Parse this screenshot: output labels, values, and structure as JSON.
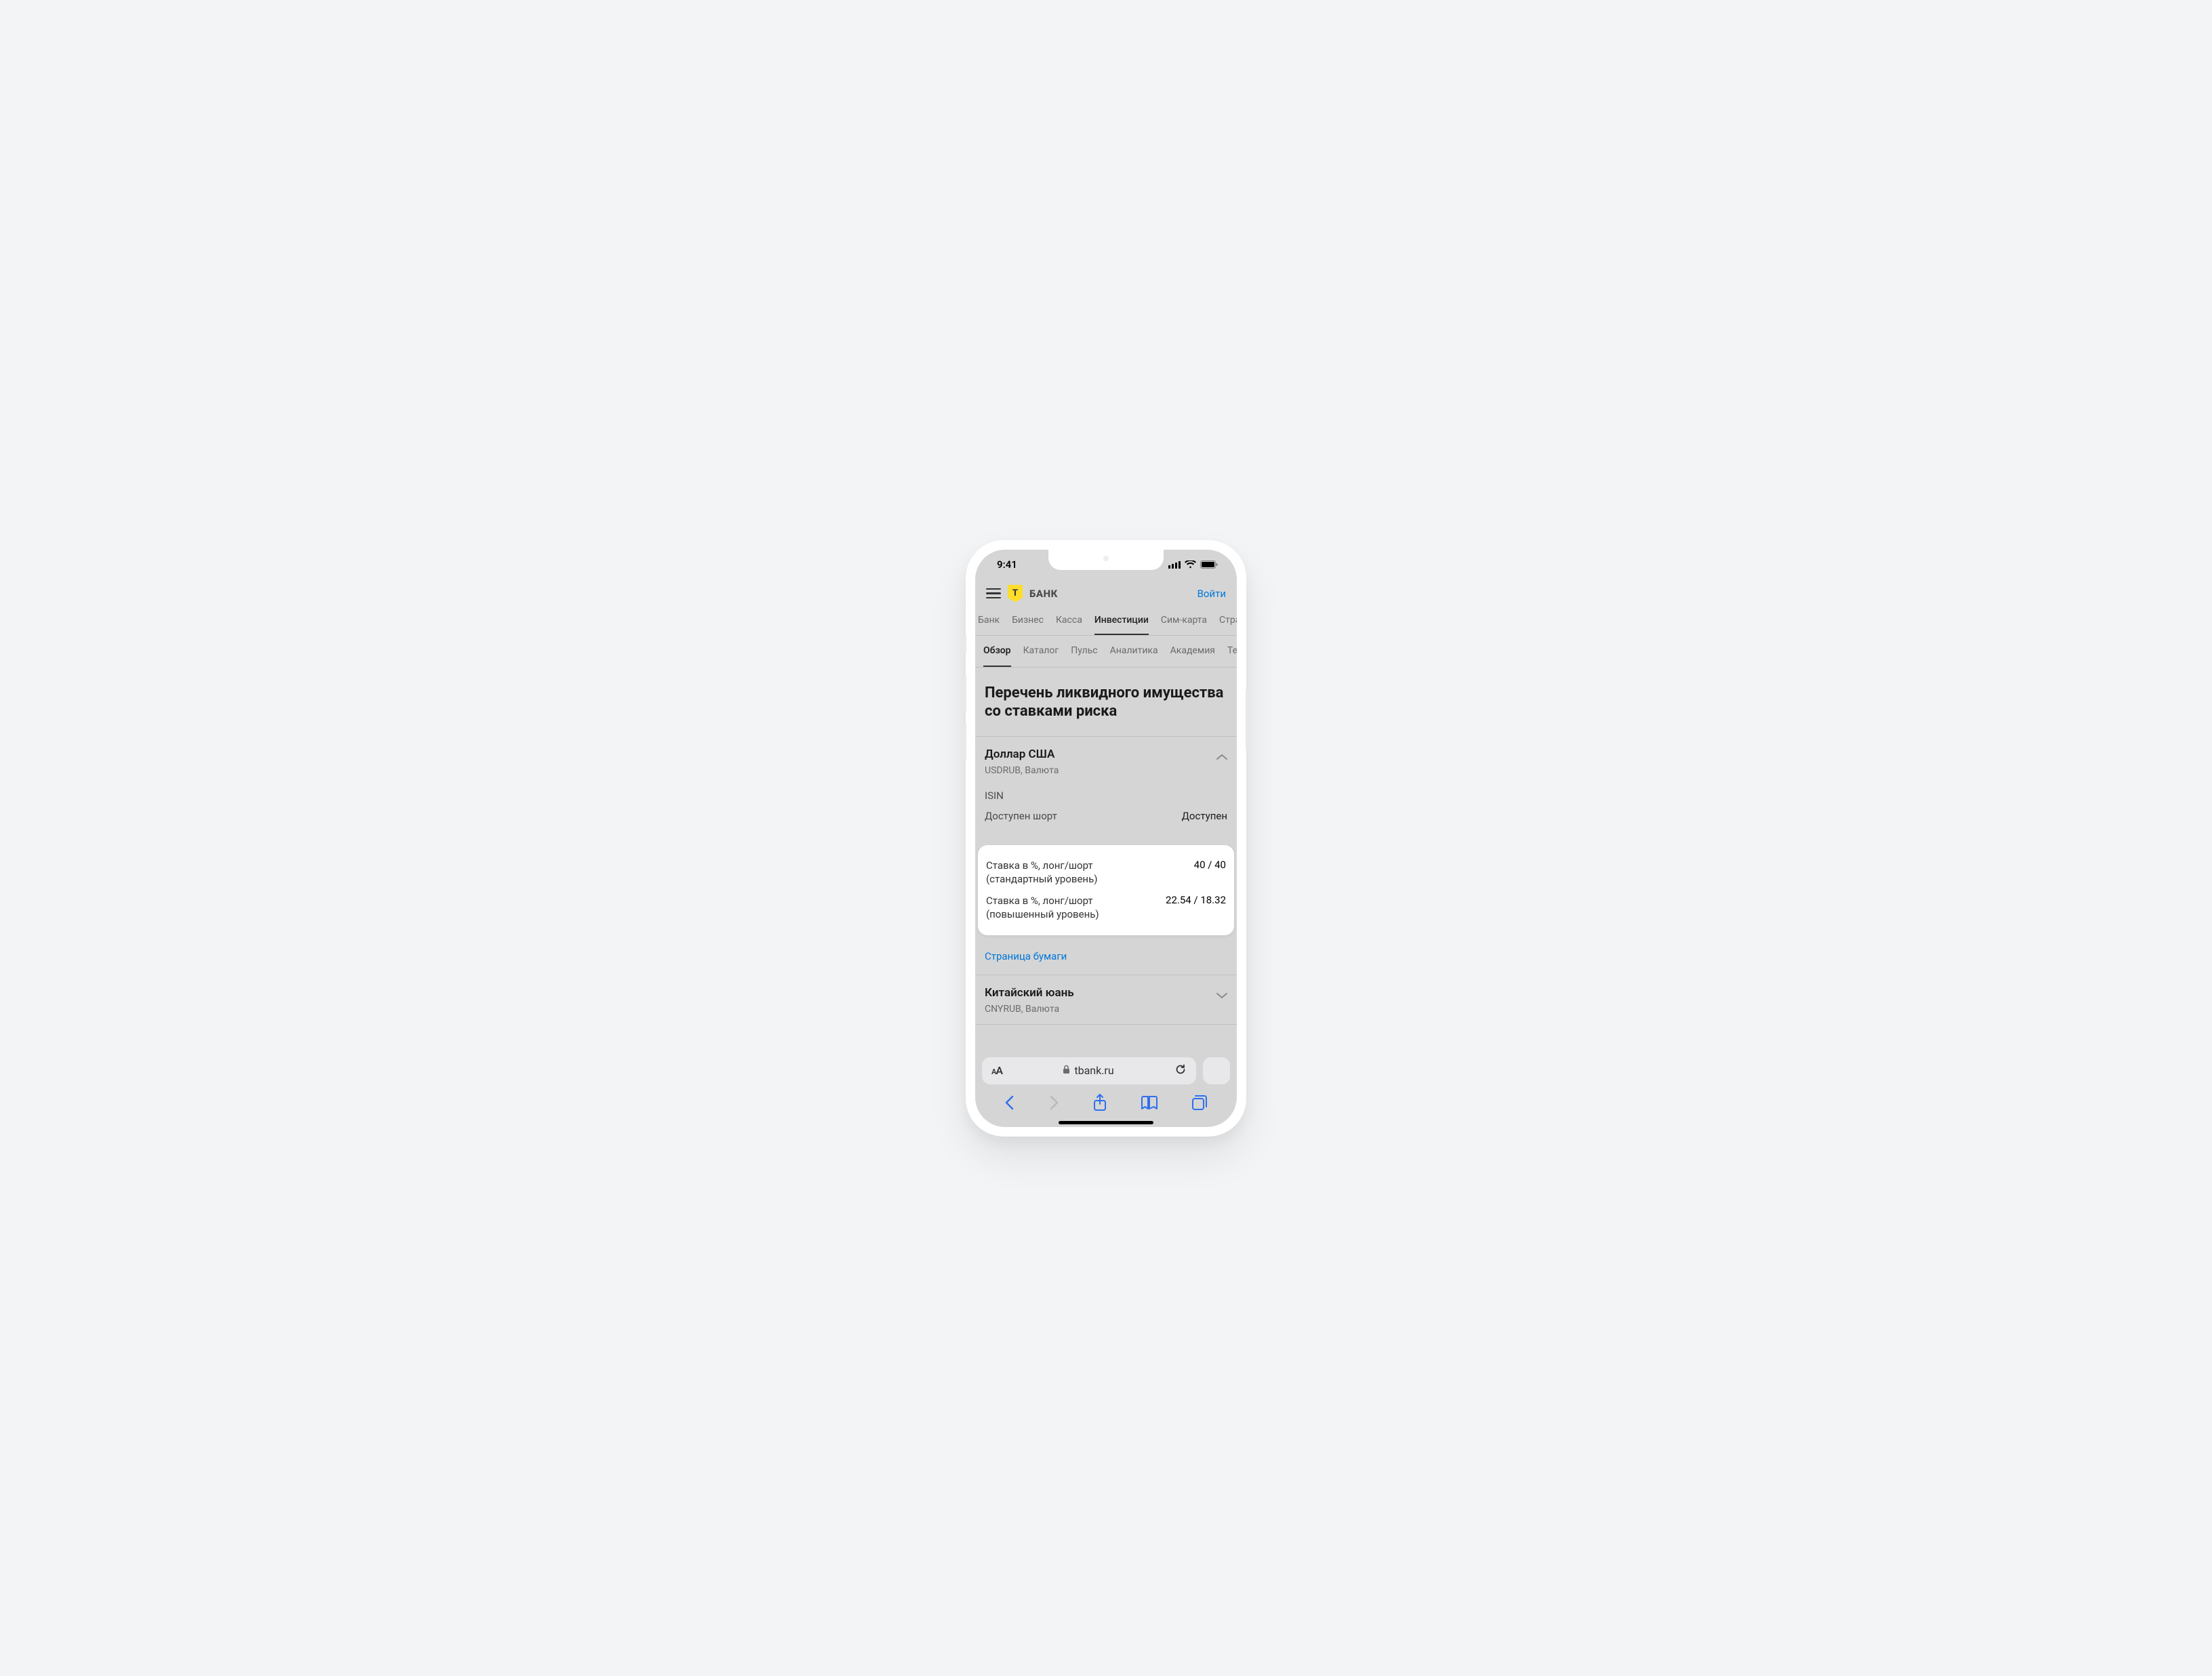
{
  "status": {
    "time": "9:41"
  },
  "header": {
    "brand": "БАНК",
    "brand_letter": "T",
    "login": "Войти"
  },
  "nav": {
    "items": [
      "Банк",
      "Бизнес",
      "Касса",
      "Инвестиции",
      "Сим-карта",
      "Страхован"
    ],
    "active_index": 3
  },
  "subnav": {
    "items": [
      "Обзор",
      "Каталог",
      "Пульс",
      "Аналитика",
      "Академия",
      "Термин"
    ],
    "active_index": 0
  },
  "page": {
    "title": "Перечень ликвидного имущества со ставками риска"
  },
  "items": [
    {
      "title": "Доллар США",
      "subtitle": "USDRUB, Валюта",
      "expanded": true,
      "isin_label": "ISIN",
      "short_label": "Доступен шорт",
      "short_value": "Доступен",
      "rate_std_label": "Ставка в %, лонг/шорт",
      "rate_std_sub": "(стандартный уровень)",
      "rate_std_value": "40 / 40",
      "rate_high_label": "Ставка в %, лонг/шорт",
      "rate_high_sub": "(повышенный уровень)",
      "rate_high_value": "22.54 / 18.32",
      "page_link": "Страница бумаги"
    },
    {
      "title": "Китайский юань",
      "subtitle": "CNYRUB, Валюта",
      "expanded": false
    }
  ],
  "browser": {
    "url": "tbank.ru"
  }
}
